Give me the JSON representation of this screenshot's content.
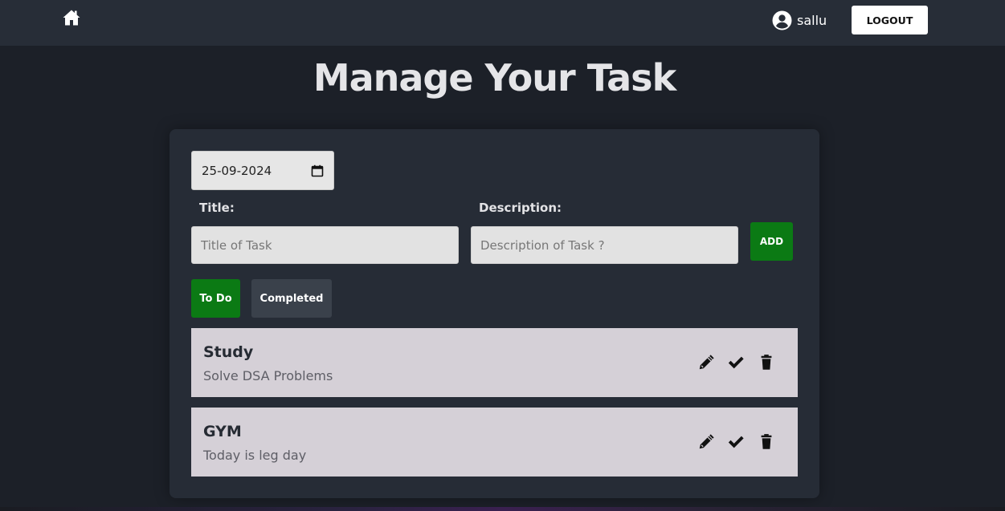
{
  "navbar": {
    "home_icon": "home-icon",
    "user_icon": "user-circle-icon",
    "username": "sallu",
    "logout_label": "LOGOUT"
  },
  "page": {
    "title": "Manage Your Task"
  },
  "form": {
    "date_value": "25-09-2024",
    "calendar_icon": "calendar-icon",
    "title_label": "Title:",
    "title_placeholder": "Title of Task",
    "description_label": "Description:",
    "description_placeholder": "Description of Task ?",
    "add_label": "ADD"
  },
  "tabs": {
    "todo_label": "To Do",
    "completed_label": "Completed",
    "active": "To Do"
  },
  "tasks": [
    {
      "title": "Study",
      "description": "Solve DSA Problems"
    },
    {
      "title": "GYM",
      "description": "Today is leg day"
    }
  ],
  "colors": {
    "accent_green": "#0b7a14",
    "navbar_bg": "#272d37",
    "page_bg": "#1c2028",
    "card_bg": "#262c36",
    "task_bg": "#d5d0d7"
  }
}
